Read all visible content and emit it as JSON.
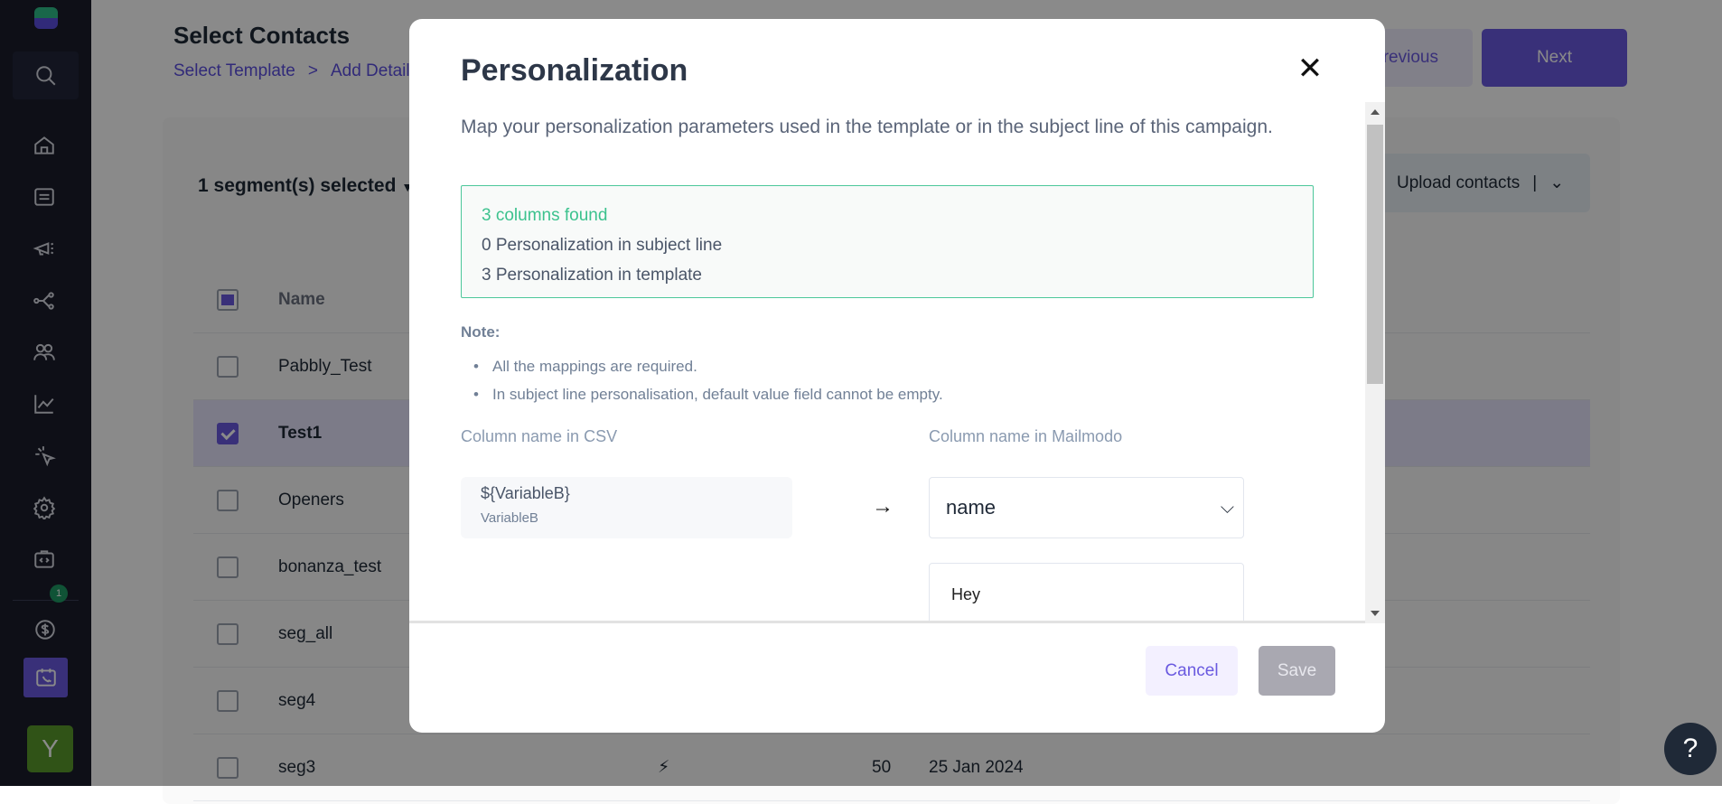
{
  "sidebar": {
    "badge_count": "1",
    "avatar_initial": "Y"
  },
  "header": {
    "title": "Select Contacts",
    "breadcrumb": [
      "Select Template",
      ">",
      "Add Details"
    ],
    "previous_label": "Previous",
    "next_label": "Next"
  },
  "card": {
    "segment_selector": "1 segment(s) selected",
    "upload_label": "Upload contacts",
    "table_header": "Name",
    "rows": [
      {
        "name": "Pabbly_Test",
        "checked": false
      },
      {
        "name": "Test1",
        "checked": true
      },
      {
        "name": "Openers",
        "checked": false
      },
      {
        "name": "bonanza_test",
        "checked": false
      },
      {
        "name": "seg_all",
        "checked": false
      },
      {
        "name": "seg4",
        "checked": false
      },
      {
        "name": "seg3",
        "checked": false,
        "count": "50",
        "date": "25 Jan 2024"
      }
    ]
  },
  "modal": {
    "title": "Personalization",
    "description": "Map your personalization parameters used in the template or in the subject line of this campaign.",
    "summary": {
      "columns_found": "3 columns found",
      "subject_line": "0 Personalization in subject line",
      "template": "3 Personalization in template"
    },
    "note_label": "Note:",
    "notes": [
      "All the mappings are required.",
      "In subject line personalisation, default value field cannot be empty."
    ],
    "csv_header": "Column name in CSV",
    "mailmodo_header": "Column name in Mailmodo",
    "mapping": {
      "variable": "${VariableB}",
      "variable_name": "VariableB",
      "arrow": "→",
      "selected": "name",
      "default_value": "Hey"
    },
    "cancel_label": "Cancel",
    "save_label": "Save"
  },
  "help_label": "?",
  "colors": {
    "accent": "#6a5ae0",
    "success": "#3cc28e"
  }
}
